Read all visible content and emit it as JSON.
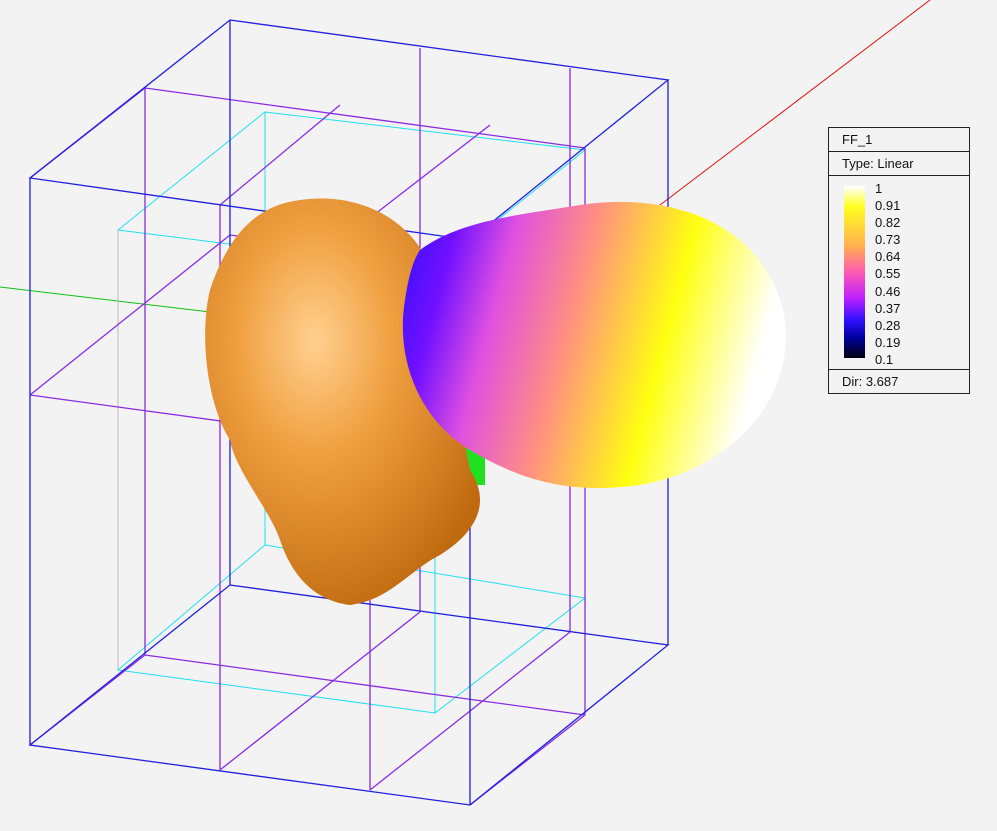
{
  "legend": {
    "title": "FF_1",
    "type_label": "Type: Linear",
    "ticks": [
      "1",
      "0.91",
      "0.82",
      "0.73",
      "0.64",
      "0.55",
      "0.46",
      "0.37",
      "0.28",
      "0.19",
      "0.1"
    ],
    "directivity": "Dir: 3.687"
  },
  "colors": {
    "outer_box": "#2020e0",
    "middle_box": "#8a2be2",
    "inner_box": "#20e0f0",
    "head": "#f0a040",
    "x_axis": "#e01010",
    "y_axis": "#10c010",
    "feed": "#20e020"
  }
}
